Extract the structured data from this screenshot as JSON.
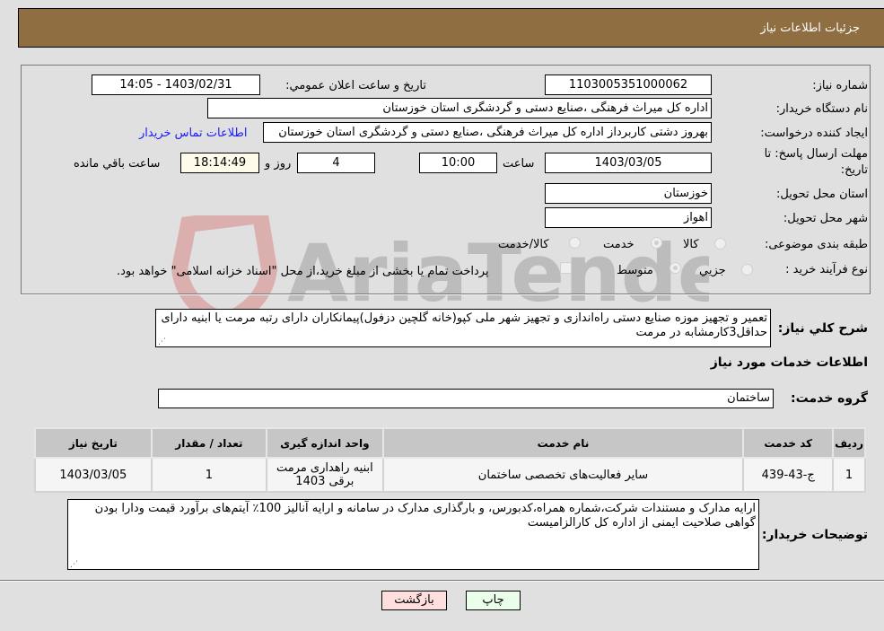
{
  "header": {
    "title": "جزئیات اطلاعات نیاز"
  },
  "form": {
    "need_number": {
      "label": "شماره نیاز:",
      "value": "1103005351000062"
    },
    "announce_datetime": {
      "label": "تاریخ و ساعت اعلان عمومي:",
      "value": "1403/02/31 - 14:05"
    },
    "buyer_org": {
      "label": "نام دستگاه خريدار:",
      "value": "اداره کل میراث فرهنگی ،صنایع دستی و گردشگری استان خوزستان"
    },
    "requester": {
      "label": "ایجاد کننده درخواست:",
      "value": "بهروز دشتی کاربرداز اداره کل میراث فرهنگی ،صنایع دستی و گردشگری استان خوزستان"
    },
    "buyer_contact_link": "اطلاعات تماس خريدار",
    "deadline": {
      "label_line1": "مهلت ارسال پاسخ: تا",
      "label_line2": "تاريخ:",
      "date": "1403/03/05",
      "time_label": "ساعت",
      "time": "10:00",
      "days": "4",
      "days_label": "روز و",
      "remaining": "18:14:49",
      "remaining_label": "ساعت باقي مانده"
    },
    "delivery_province": {
      "label": "استان محل تحویل:",
      "value": "خوزستان"
    },
    "delivery_city": {
      "label": "شهر محل تحویل:",
      "value": "اهواز"
    },
    "category": {
      "label": "طبقه بندی موضوعی:",
      "options": [
        "کالا",
        "خدمت",
        "کالا/خدمت"
      ],
      "selected": "خدمت"
    },
    "purchase_type": {
      "label": "نوع فرآیند خرید :",
      "options": [
        "جزيي",
        "متوسط"
      ],
      "selected": "متوسط",
      "treasury_note": "پرداخت تمام يا بخشی از مبلغ خريد،از محل \"اسناد خزانه اسلامی\" خواهد بود."
    }
  },
  "description": {
    "label": "شرح کلي نياز:",
    "text": "تعمیر و تجهیز موزه صنایع دستی راه‌اندازی و تجهیز شهر ملی کپو(خانه گلچین دزفول)پیمانکاران دارای رتبه مرمت  یا ابنیه دارای حداقل3کارمشابه در مرمت"
  },
  "services": {
    "section_title": "اطلاعات خدمات مورد نياز",
    "group_label": "گروه خدمت:",
    "group_value": "ساختمان",
    "table": {
      "columns": [
        "رديف",
        "کد خدمت",
        "نام خدمت",
        "واحد اندازه گيری",
        "تعداد / مقدار",
        "تاريخ نياز"
      ],
      "rows": [
        [
          "1",
          "ج-43-439",
          "سایر فعالیت‌های تخصصی ساختمان",
          "ابنیه راهداری مرمت برقی 1403",
          "1",
          "1403/03/05"
        ]
      ]
    }
  },
  "buyer_notes": {
    "label": "توضيحات خريدار:",
    "text": "ارایه مدارک و مستندات شرکت،شماره همراه،کدبورس، و بارگذاری مدارک در سامانه و ارایه آنالیز 100٪ آیتم‌های برآورد قیمت ودارا بودن گواهی صلاحیت ایمنی از اداره کل کارالزامیست"
  },
  "buttons": {
    "print": "چاپ",
    "back": "بازگشت"
  },
  "colors": {
    "header_bg": "#8f6e42",
    "print_bg": "#eaffea",
    "back_bg": "#ffdede",
    "link": "#1a1aff"
  },
  "watermark": "AriaTender.neT"
}
